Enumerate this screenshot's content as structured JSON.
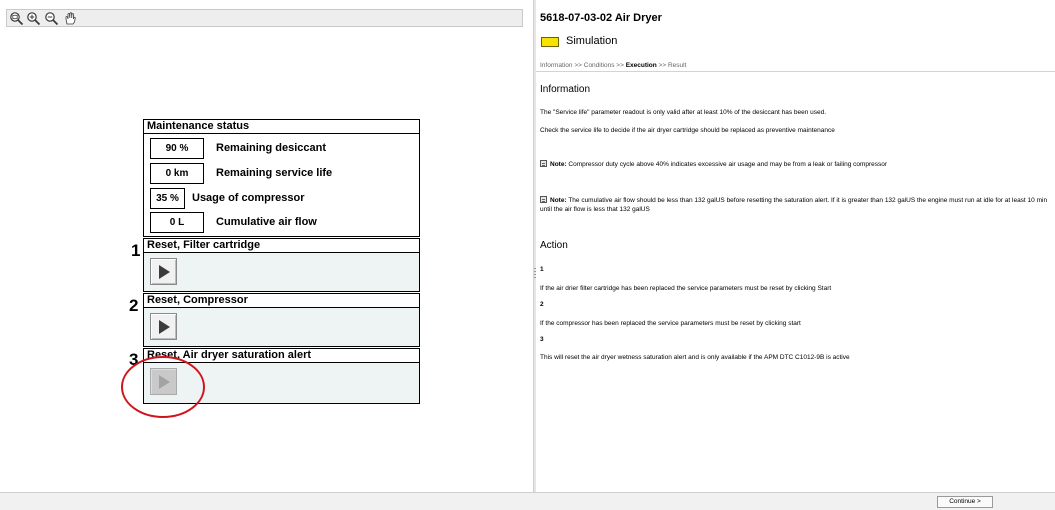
{
  "toolbar": {
    "tools": [
      "zoom-fit-icon",
      "zoom-in-icon",
      "zoom-out-icon",
      "pan-hand-icon"
    ]
  },
  "maintenance": {
    "title": "Maintenance status",
    "rows": [
      {
        "value": "90 %",
        "label": "Remaining desiccant"
      },
      {
        "value": "0 km",
        "label": "Remaining service life"
      },
      {
        "value": "35 %",
        "label": "Usage of compressor"
      },
      {
        "value": "0 L",
        "label": "Cumulative air flow"
      }
    ]
  },
  "resets": [
    {
      "number": "1",
      "title": "Reset, Filter cartridge",
      "enabled": true
    },
    {
      "number": "2",
      "title": "Reset, Compressor",
      "enabled": true
    },
    {
      "number": "3",
      "title": "Reset, Air dryer saturation alert",
      "enabled": false
    }
  ],
  "doc": {
    "title": "5618-07-03-02 Air Dryer",
    "simulation_label": "Simulation",
    "breadcrumb": {
      "information": "Information",
      "conditions": "Conditions",
      "execution": "Execution",
      "result": "Result",
      "separator": ">>"
    },
    "information": {
      "heading": "Information",
      "para1": "The \"Service life\" parameter readout is only valid after at least 10% of the desiccant has been used.",
      "para2": "Check the service life to decide if the air dryer cartridge should be replaced as preventive maintenance",
      "note1_label": "Note:",
      "note1_text": "Compressor duty cycle above 40% indicates excessive air usage and may be from a leak or failing compressor",
      "note2_label": "Note:",
      "note2_text": "The cumulative air flow should be less than 132 galUS before resetting the saturation alert. If it is greater than 132 galUS the engine must run at idle for at least 10 min until the air flow is less that 132 galUS"
    },
    "action": {
      "heading": "Action",
      "steps": [
        {
          "number": "1",
          "text": "If the air drier filter cartridge has been replaced the service parameters must be reset by clicking Start"
        },
        {
          "number": "2",
          "text": "If the compressor has been replaced the service parameters must be reset by clicking start"
        },
        {
          "number": "3",
          "text": "This will reset the air dryer wetness saturation alert and is only available if the APM DTC C1012-9B is active"
        }
      ]
    }
  },
  "footer": {
    "continue_label": "Continue >"
  },
  "colors": {
    "simulation_swatch": "#f6e400",
    "highlight_circle": "#d0141e",
    "reset_panel_bg": "#eef4f3"
  }
}
